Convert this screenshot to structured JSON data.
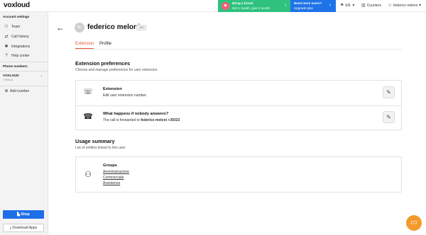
{
  "app": {
    "logo": "voxloud"
  },
  "topbar": {
    "promo_friend": {
      "title": "Bring a friend",
      "subtitle": "Get 1 month, give 1 month"
    },
    "promo_upgrade": {
      "title": "Need more users?",
      "subtitle": "Upgrade plan"
    },
    "language": "EN",
    "counters_label": "Counters",
    "user_label": "federico meloni",
    "colors": {
      "green": "#2ec27e",
      "blue": "#1e73e8"
    }
  },
  "sidebar": {
    "account_settings_label": "Account settings",
    "items": [
      {
        "label": "Team",
        "icon": "team-icon"
      },
      {
        "label": "Call history",
        "icon": "call-history-icon"
      },
      {
        "label": "Integrations",
        "icon": "integrations-icon"
      },
      {
        "label": "Help center",
        "icon": "help-icon"
      }
    ],
    "phone_numbers_label": "Phone numbers",
    "phone_account": {
      "name": "VOXLOUD",
      "number": "+399444"
    },
    "add_number_label": "Add number",
    "shop_label": "Shop",
    "download_label": "Download Apps"
  },
  "profile": {
    "avatar_initials": "fm",
    "name": "federico meloni",
    "extension": "101"
  },
  "tabs": [
    {
      "label": "Extension",
      "active": true
    },
    {
      "label": "Profile",
      "active": false
    }
  ],
  "extension_preferences": {
    "title": "Extension preferences",
    "subtitle": "Choose and manage preferences for user extension",
    "rows": [
      {
        "title": "Extension",
        "subtitle": "Edit user extension number."
      },
      {
        "title": "What happens if nobody answers?",
        "subtitle_prefix": "The call is forwarded to",
        "subtitle_target": "federico meloni +39323"
      }
    ]
  },
  "usage_summary": {
    "title": "Usage summary",
    "subtitle": "List of entities linked to this user",
    "groups_title": "Groups",
    "groups": [
      "Amministrazione",
      "Commerciale",
      "Assistenza"
    ]
  },
  "accent_color": "#e4533a"
}
